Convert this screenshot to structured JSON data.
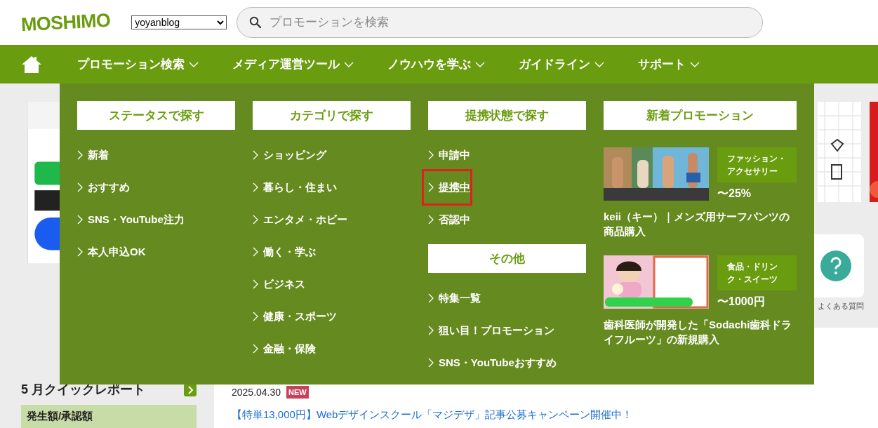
{
  "header": {
    "logo": "MOSHIMO",
    "site_select": {
      "value": "yoyanblog"
    },
    "search": {
      "placeholder": "プロモーションを検索"
    }
  },
  "nav": {
    "items": [
      {
        "label": "プロモーション検索"
      },
      {
        "label": "メディア運営ツール"
      },
      {
        "label": "ノウハウを学ぶ"
      },
      {
        "label": "ガイドライン"
      },
      {
        "label": "サポート"
      }
    ]
  },
  "mega_menu": {
    "columns": [
      {
        "groups": [
          {
            "heading": "ステータスで探す",
            "links": [
              {
                "label": "新着",
                "selected": false
              },
              {
                "label": "おすすめ",
                "selected": false
              },
              {
                "label": "SNS・YouTube注力",
                "selected": false
              },
              {
                "label": "本人申込OK",
                "selected": false
              }
            ]
          }
        ]
      },
      {
        "groups": [
          {
            "heading": "カテゴリで探す",
            "links": [
              {
                "label": "ショッピング",
                "selected": false
              },
              {
                "label": "暮らし・住まい",
                "selected": false
              },
              {
                "label": "エンタメ・ホビー",
                "selected": false
              },
              {
                "label": "働く・学ぶ",
                "selected": false
              },
              {
                "label": "ビジネス",
                "selected": false
              },
              {
                "label": "健康・スポーツ",
                "selected": false
              },
              {
                "label": "金融・保険",
                "selected": false
              }
            ]
          }
        ]
      },
      {
        "groups": [
          {
            "heading": "提携状態で探す",
            "links": [
              {
                "label": "申請中",
                "selected": false
              },
              {
                "label": "提携中",
                "selected": true
              },
              {
                "label": "否認中",
                "selected": false
              }
            ]
          },
          {
            "heading": "その他",
            "links": [
              {
                "label": "特集一覧",
                "selected": false
              },
              {
                "label": "狙い目！プロモーション",
                "selected": false
              },
              {
                "label": "SNS・YouTubeおすすめ",
                "selected": false
              }
            ]
          }
        ]
      }
    ],
    "new_promotions": {
      "heading": "新着プロモーション",
      "promotions": [
        {
          "image": {
            "kind": "picture"
          },
          "category_lines": [
            "ファッション・",
            "アクセサリー"
          ],
          "reward": "〜25%",
          "title": "keii（キー）｜メンズ用サーフパンツの商品購入"
        },
        {
          "image": {
            "kind": "picture"
          },
          "category_lines": [
            "食品・ドリン",
            "ク・スイーツ"
          ],
          "reward": "〜1000円",
          "title": "歯科医師が開発した「Sodachi歯科ドライフルーツ」の新規購入"
        }
      ]
    }
  },
  "sidebar": {
    "quick_report": {
      "title": "5 月クイックレポート",
      "row_label": "発生額/承認額"
    }
  },
  "shortcuts": [
    {
      "label": "よくある質問"
    }
  ],
  "news": {
    "items": [
      {
        "date": "2025.04.30",
        "badge": "NEW",
        "title": "【特単13,000円】Webデザインスクール「マジデザ」記事公募キャンペーン開催中！"
      }
    ]
  }
}
